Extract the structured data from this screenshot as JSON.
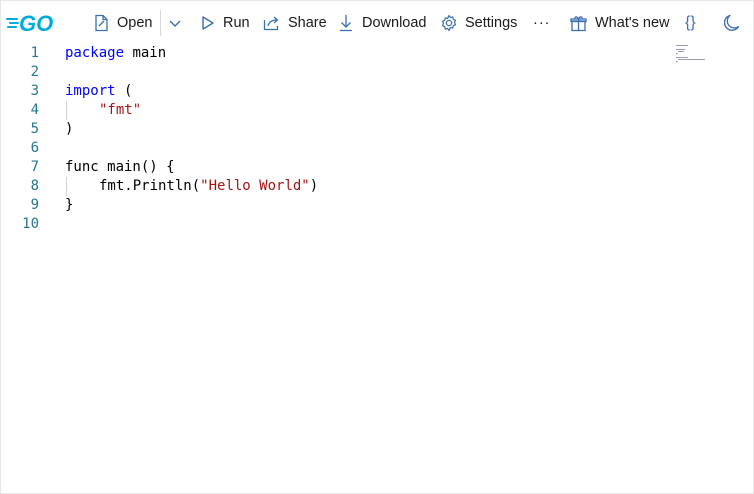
{
  "toolbar": {
    "logo": {
      "alt": "GO",
      "icon": "go-logo",
      "color": "#00ADD8"
    },
    "open": {
      "label": "Open",
      "icon": "file-icon"
    },
    "dropdown": {
      "icon": "chevron-down-icon"
    },
    "run": {
      "label": "Run",
      "icon": "play-icon"
    },
    "share": {
      "label": "Share",
      "icon": "share-icon"
    },
    "download": {
      "label": "Download",
      "icon": "download-icon"
    },
    "settings": {
      "label": "Settings",
      "icon": "gear-icon"
    },
    "more": {
      "label": "···",
      "icon": "more-icon"
    },
    "whats_new": {
      "label": "What's new",
      "icon": "gift-icon"
    },
    "format": {
      "label": "{}",
      "icon": "braces-icon"
    },
    "theme": {
      "icon": "moon-icon"
    }
  },
  "editor": {
    "line_numbers": [
      "1",
      "2",
      "3",
      "4",
      "5",
      "6",
      "7",
      "8",
      "9",
      "10"
    ],
    "lines": {
      "l1_kw": "package",
      "l1_rest": " main",
      "l3_kw": "import",
      "l3_rest": " (",
      "l4_str": "\"fmt\"",
      "l5": ")",
      "l7": "func main() {",
      "l8_pre": "fmt.Println(",
      "l8_str": "\"Hello World\"",
      "l8_post": ")",
      "l9": "}"
    },
    "colors": {
      "keyword": "#0000ff",
      "string": "#a31515",
      "line_number": "#237893"
    }
  }
}
